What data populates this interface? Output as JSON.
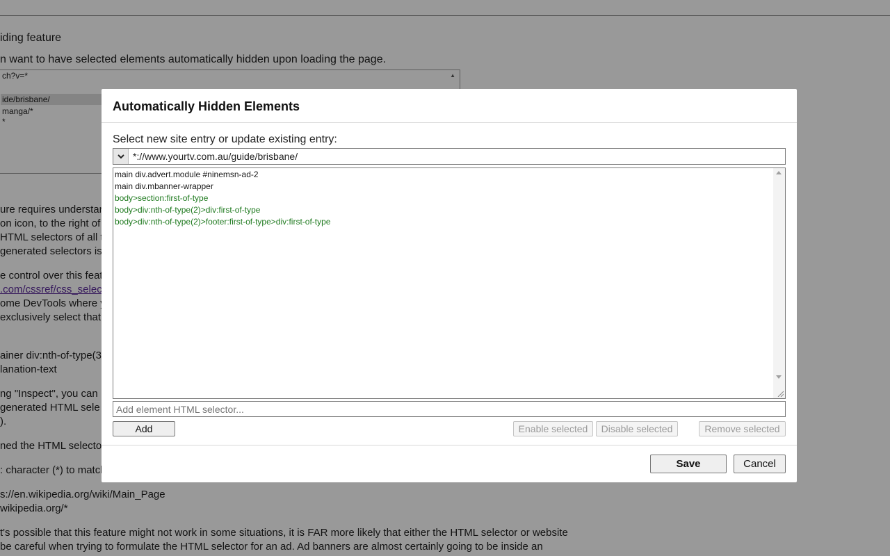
{
  "background": {
    "heading": "iding feature",
    "intro": "n want to have selected elements automatically hidden upon loading the page.",
    "list_entries": [
      "ch?v=*",
      "ide/brisbane/",
      "manga/*",
      "*"
    ],
    "paragraph_lines": [
      "ure requires understan",
      "on icon, to the right of",
      "HTML selectors of all t",
      "generated selectors is",
      "e control over this feat",
      ".com/cssref/css_selecto",
      "ome DevTools where yo",
      "exclusively select that",
      "ainer div:nth-of-type(3",
      "lanation-text",
      "ng \"Inspect\", you can",
      "generated HTML sele",
      ").",
      "ned the HTML selector",
      ": character (*) to match",
      "s://en.wikipedia.org/wiki/Main_Page",
      "wikipedia.org/*",
      "t's possible that this feature might not work in some situations, it is FAR more likely that either the HTML selector or website",
      "be careful when trying to formulate the HTML selector for an ad. Ad banners are almost certainly going to be inside an"
    ]
  },
  "dialog": {
    "title": "Automatically Hidden Elements",
    "prompt": "Select new site entry or update existing entry:",
    "site_value": "*://www.yourtv.com.au/guide/brisbane/",
    "selectors": [
      {
        "text": "main div.advert.module #ninemsn-ad-2",
        "enabled": true
      },
      {
        "text": "main div.mbanner-wrapper",
        "enabled": true
      },
      {
        "text": "body>section:first-of-type",
        "enabled": false
      },
      {
        "text": "body>div:nth-of-type(2)>div:first-of-type",
        "enabled": false
      },
      {
        "text": "body>div:nth-of-type(2)>footer:first-of-type>div:first-of-type",
        "enabled": false
      }
    ],
    "add_placeholder": "Add element HTML selector...",
    "buttons": {
      "add": "Add",
      "enable_selected": "Enable selected",
      "disable_selected": "Disable selected",
      "remove_selected": "Remove selected",
      "save": "Save",
      "cancel": "Cancel"
    }
  },
  "colors": {
    "overlay": "rgba(0,0,0,0.40)",
    "enabled_selector": "#1a1a1a",
    "disabled_selector": "#1f7a1f",
    "link": "#5a2a9a"
  }
}
